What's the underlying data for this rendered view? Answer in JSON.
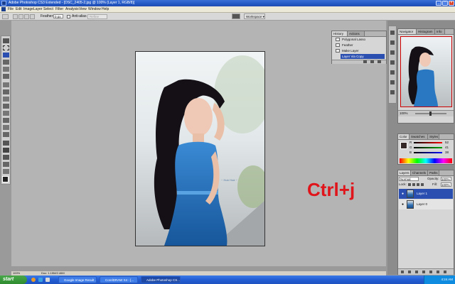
{
  "window": {
    "title": "Adobe Photoshop CS3 Extended - [DSC_2405-2.jpg @ 100% (Layer 1, RGB/8)]"
  },
  "menu": [
    "File",
    "Edit",
    "Image",
    "Layer",
    "Select",
    "Filter",
    "Analysis",
    "View",
    "Window",
    "Help"
  ],
  "options_bar": {
    "feather_label": "Feather:",
    "feather_value": "0 px",
    "antialias_label": "Anti-alias",
    "refine_edge": "Refine Edge...",
    "workspace": "Workspace ▾"
  },
  "history_panel": {
    "tabs": [
      "History",
      "Actions"
    ],
    "items": [
      "Polygonal Lasso",
      "Feather",
      "Make Layer",
      "Layer Via Copy"
    ],
    "selected_index": 3
  },
  "navigator_panel": {
    "tabs": [
      "Navigator",
      "Histogram",
      "Info"
    ],
    "zoom": "100%"
  },
  "color_panel": {
    "tabs": [
      "Color",
      "Swatches",
      "Styles"
    ],
    "channels": [
      "R",
      "G",
      "B"
    ],
    "values": [
      "52",
      "41",
      "38"
    ]
  },
  "layers_panel": {
    "tabs": [
      "Layers",
      "Channels",
      "Paths"
    ],
    "blend_mode": "Normal",
    "opacity_label": "Opacity:",
    "opacity_value": "100%",
    "lock_label": "Lock:",
    "fill_label": "Fill:",
    "fill_value": "100%",
    "layers": [
      {
        "name": "Layer 1",
        "selected": true
      },
      {
        "name": "Layer 0",
        "selected": false
      }
    ]
  },
  "overlay_text": "Ctrl+j",
  "watermark": "~ Hoà Hoà ~",
  "status_bar": {
    "zoom": "100%",
    "doc": "Doc: 1.15M/2.46M"
  },
  "taskbar": {
    "start": "start",
    "tasks": [
      "Google Image Result ...",
      "CorelDRAW X4 - [...",
      "Adobe Photoshop CS..."
    ],
    "clock": "4:24 AM"
  },
  "colors": {
    "accent_text": "#e0151b",
    "selection": "#2a4fb0",
    "dress_blue": "#1f6fb8"
  }
}
